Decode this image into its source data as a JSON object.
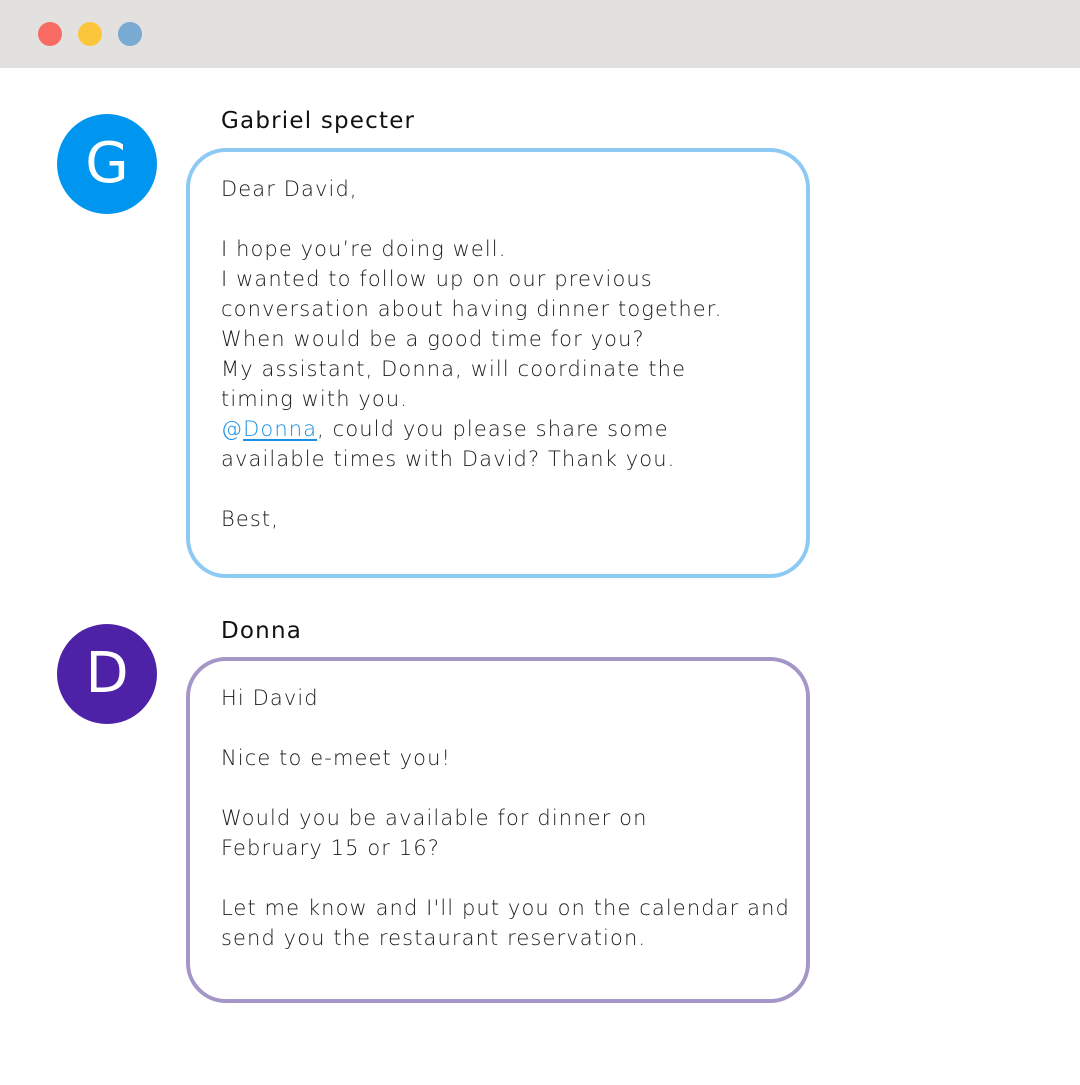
{
  "window": {
    "controls": [
      "close",
      "minimize",
      "zoom"
    ],
    "colors": {
      "close": "#f76b63",
      "minimize": "#fcc63c",
      "zoom": "#78aad2"
    }
  },
  "messages": [
    {
      "avatar_letter": "G",
      "avatar_color": "#0096f0",
      "bubble_border_color": "#8cc9f3",
      "sender": "Gabriel specter",
      "lines": [
        "Dear David,",
        "",
        "I hope you’re doing well.",
        "I wanted to follow up on our previous",
        "conversation about having dinner together.",
        "When would be a good time for you?",
        "My assistant, Donna, will coordinate the",
        "timing with you."
      ],
      "mention": {
        "at": "@",
        "name": "Donna",
        "rest": ", could you please share some"
      },
      "lines_after": [
        "available times with David? Thank you.",
        "",
        "Best,"
      ]
    },
    {
      "avatar_letter": "D",
      "avatar_color": "#4e22a7",
      "bubble_border_color": "#a596c8",
      "sender": "Donna",
      "lines": [
        "Hi David",
        "",
        "Nice to e-meet you!",
        "",
        "Would you be available for dinner on",
        "February 15 or 16?",
        "",
        "Let me know and I'll put you on the calendar and",
        "send you the restaurant reservation."
      ]
    }
  ]
}
